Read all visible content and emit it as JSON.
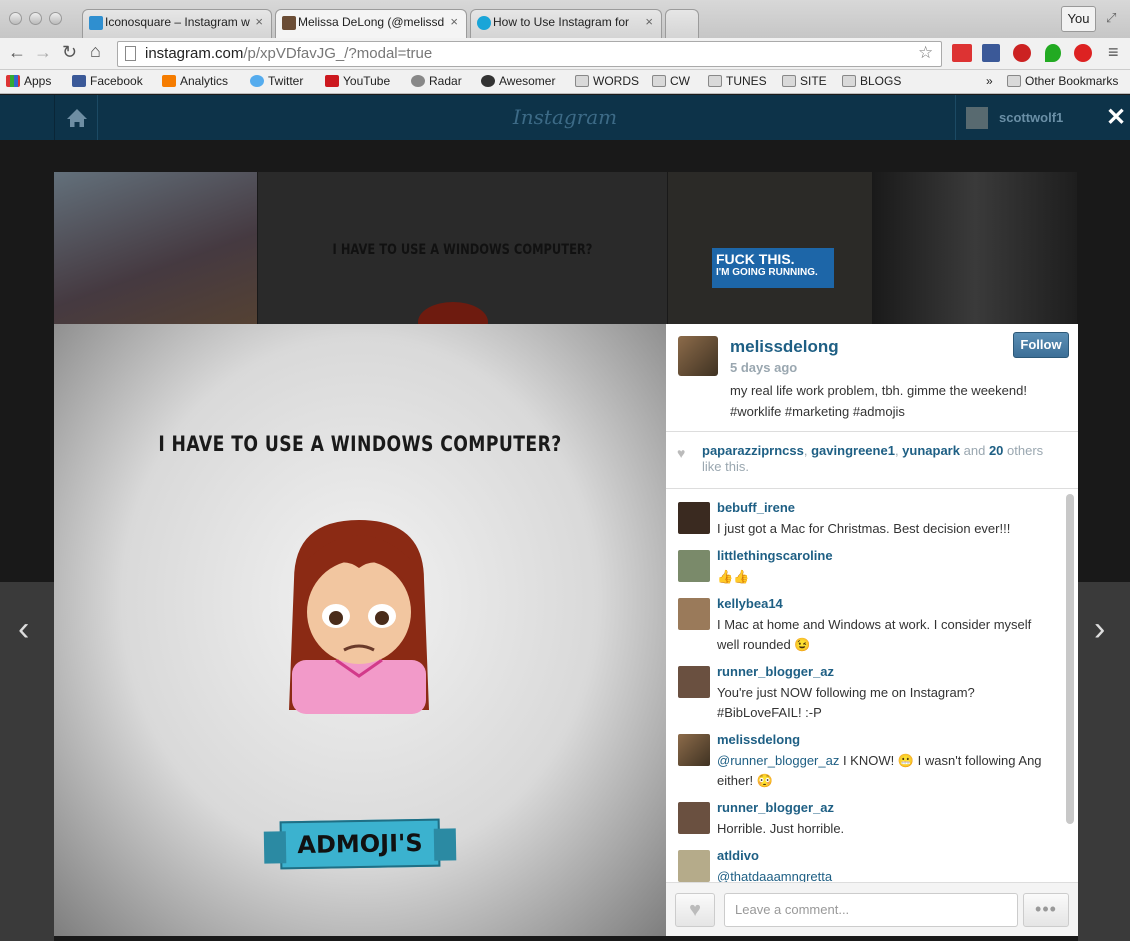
{
  "browser": {
    "tabs": [
      {
        "label": "Iconosquare – Instagram w",
        "icon": "iconosquare-icon"
      },
      {
        "label": "Melissa DeLong (@melissd",
        "icon": "instagram-icon"
      },
      {
        "label": "How to Use Instagram for",
        "icon": "about-icon"
      }
    ],
    "profile_button": "You",
    "url_host": "instagram.com",
    "url_path": "/p/xpVDfavJG_/?modal=true",
    "bookmarks": [
      "Apps",
      "Facebook",
      "Analytics",
      "Twitter",
      "YouTube",
      "Radar",
      "Awesomer",
      "WORDS",
      "CW",
      "TUNES",
      "SITE",
      "BLOGS"
    ],
    "overflow": "»",
    "other_bookmarks": "Other Bookmarks"
  },
  "instagram": {
    "logo": "Instagram",
    "user": "scottwolf1",
    "close": "✕"
  },
  "background_thumbs": {
    "thumb2_text": "I HAVE TO USE A WINDOWS COMPUTER?",
    "thumb3_line1": "FUCK THIS.",
    "thumb3_line2": "I'M GOING RUNNING."
  },
  "photo": {
    "caption": "I HAVE TO USE A WINDOWS COMPUTER?",
    "badge": "ADMOJI'S"
  },
  "post": {
    "username": "melissdelong",
    "time": "5 days ago",
    "caption": "my real life work problem, tbh. gimme the weekend! #worklife #marketing #admojis",
    "follow_label": "Follow",
    "likers": [
      "paparazziprncss",
      "gavingreene1",
      "yunapark"
    ],
    "likes_and": "and",
    "likes_count": "20",
    "likes_suffix": "others like this."
  },
  "comments": [
    {
      "user": "bebuff_irene",
      "text": "I just got a Mac for Christmas. Best decision ever!!!"
    },
    {
      "user": "littlethingscaroline",
      "text": "👍👍"
    },
    {
      "user": "kellybea14",
      "text": "I Mac at home and Windows at work. I consider myself well rounded 😉"
    },
    {
      "user": "runner_blogger_az",
      "text": "You're just NOW following me on Instagram? #BibLoveFAIL! :-P"
    },
    {
      "user": "melissdelong",
      "mention": "@runner_blogger_az",
      "text": " I KNOW! 😬 I wasn't following Ang either! 😳"
    },
    {
      "user": "runner_blogger_az",
      "text": "Horrible. Just horrible."
    },
    {
      "user": "atldivo",
      "mention": "@thatdaaamngretta",
      "text": ""
    }
  ],
  "comment_box": {
    "placeholder": "Leave a comment...",
    "more": "•••"
  },
  "nav": {
    "prev": "‹",
    "next": "›"
  },
  "colors": {
    "ig_header": "#0d3349",
    "link": "#1e5f84",
    "follow": "#3d6f97"
  }
}
